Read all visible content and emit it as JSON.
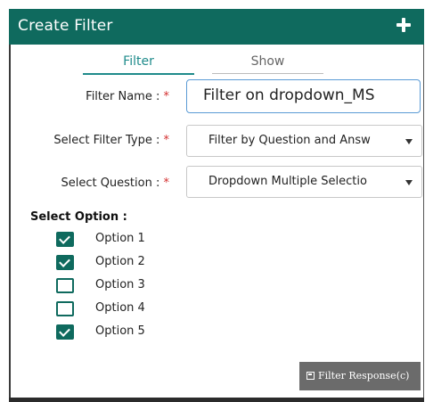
{
  "header": {
    "title": "Create Filter"
  },
  "tabs": [
    {
      "label": "Filter",
      "active": true
    },
    {
      "label": "Show",
      "active": false
    }
  ],
  "form": {
    "filter_name_label": "Filter Name :",
    "filter_name_value": "Filter on dropdown_MS",
    "filter_type_label": "Select Filter Type :",
    "filter_type_value": "Filter by Question and Answ",
    "question_label": "Select Question :",
    "question_value": "Dropdown Multiple Selectio",
    "required_mark": "*"
  },
  "options": {
    "title": "Select Option :",
    "items": [
      {
        "label": "Option 1",
        "checked": true
      },
      {
        "label": "Option 2",
        "checked": true
      },
      {
        "label": "Option 3",
        "checked": false
      },
      {
        "label": "Option 4",
        "checked": false
      },
      {
        "label": "Option 5",
        "checked": true
      }
    ]
  },
  "actions": {
    "filter_response_label": "Filter Response(c)"
  },
  "colors": {
    "header_bg": "#0f6a5e",
    "accent": "#1f8b8b",
    "required": "#d32f2f",
    "button_bg": "#6b6b6b"
  }
}
